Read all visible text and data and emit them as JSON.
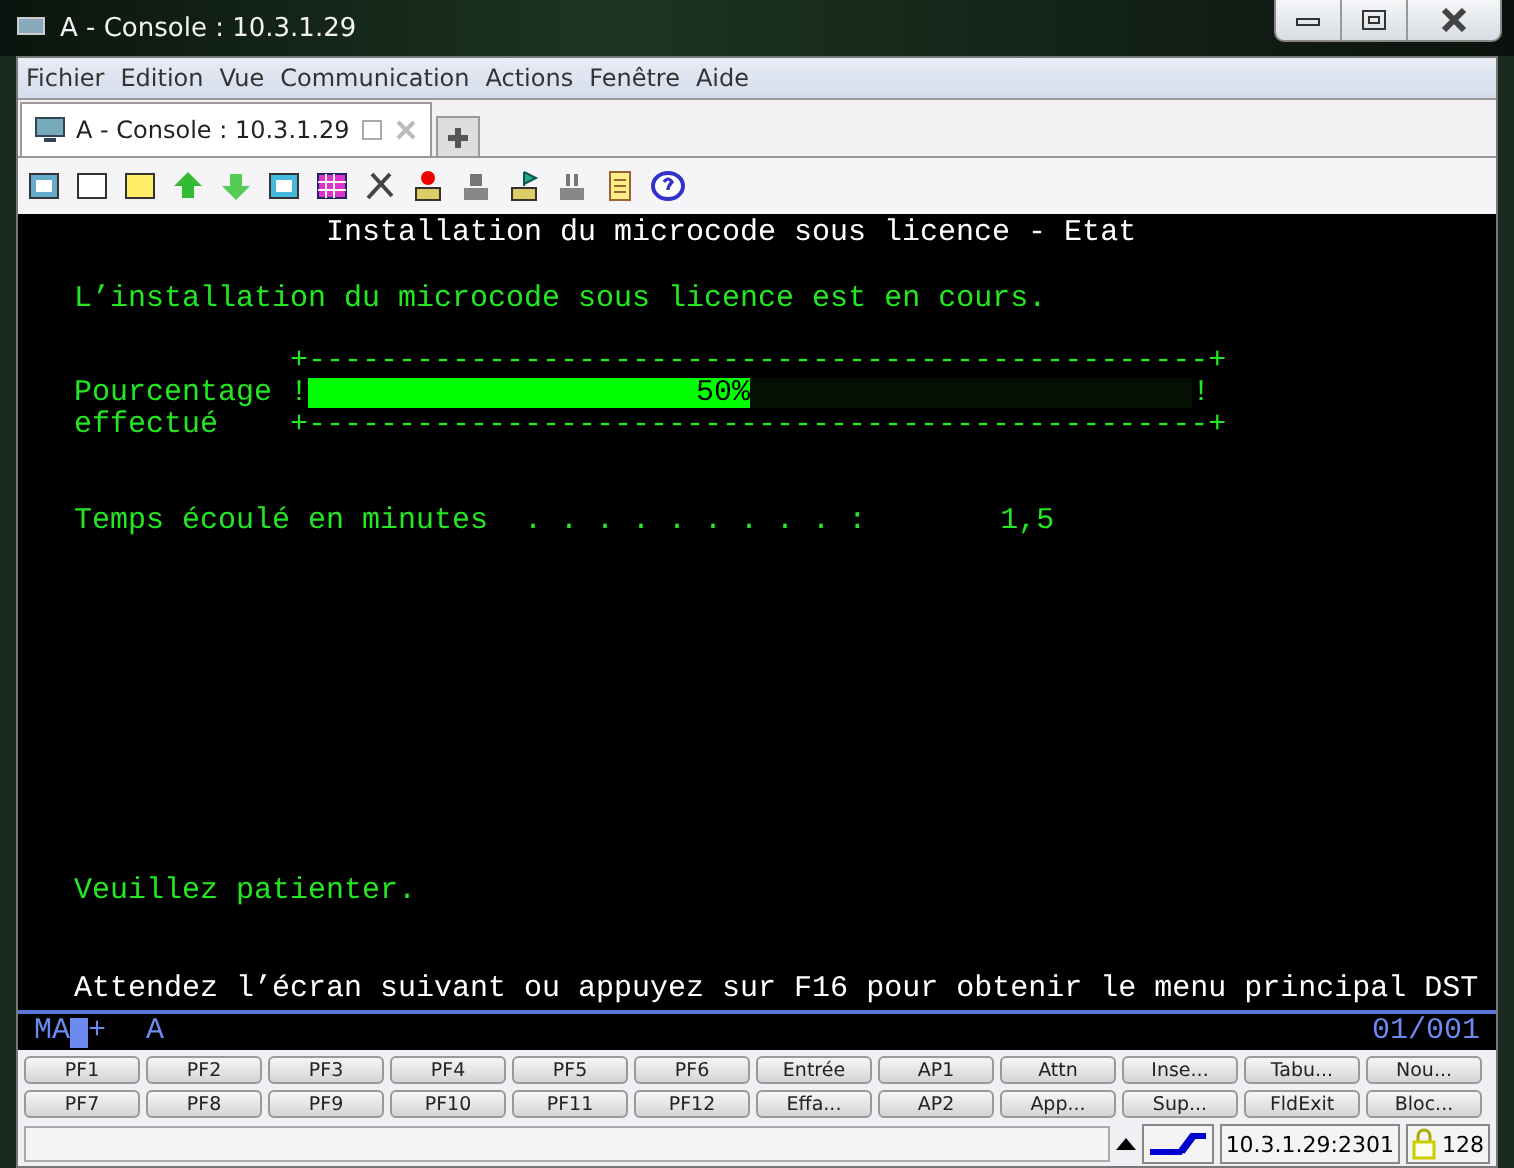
{
  "window": {
    "title": "A - Console : 10.3.1.29"
  },
  "menu": [
    "Fichier",
    "Edition",
    "Vue",
    "Communication",
    "Actions",
    "Fenêtre",
    "Aide"
  ],
  "tabs": [
    {
      "label": "A - Console : 10.3.1.29",
      "selected": true
    }
  ],
  "terminal": {
    "title": "Installation du microcode sous licence - Etat",
    "message": "L’installation du microcode sous licence est en cours.",
    "progress": {
      "border_top": "+--------------------------------------------------+",
      "label_1": "Pourcentage",
      "label_2": "effectué",
      "edge_left": "!",
      "edge_right": "!",
      "level": 0.5,
      "reading": "50%",
      "border_bottom": "+--------------------------------------------------+"
    },
    "elapsed": {
      "label": "Temps écoulé en minutes  . . . . . . . . . :",
      "value": "1,5"
    },
    "wait": "Veuillez patienter.",
    "instruction": "Attendez l’écran suivant ou appuyez sur F16 pour obtenir le menu principal DST"
  },
  "status_line": {
    "mode": "MA",
    "insert": "+",
    "shift": "A",
    "position": "01/001"
  },
  "keys": [
    [
      "PF1",
      "PF2",
      "PF3",
      "PF4",
      "PF5",
      "PF6",
      "Entrée",
      "AP1",
      "Attn",
      "Inse...",
      "Tabu...",
      "Nou..."
    ],
    [
      "PF7",
      "PF8",
      "PF9",
      "PF10",
      "PF11",
      "PF12",
      "Effa...",
      "AP2",
      "App...",
      "Sup...",
      "FldExit",
      "Bloc..."
    ]
  ],
  "status_bar": {
    "address": "10.3.1.29:2301",
    "encryption": "128"
  }
}
